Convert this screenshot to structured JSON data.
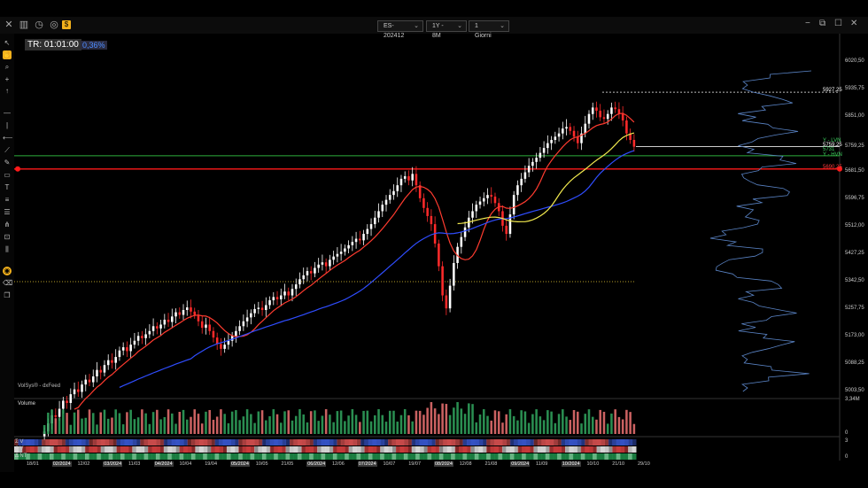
{
  "topbar": {
    "contract": "ES-202412",
    "range": "1Y - 8M",
    "period": "1 Giorni",
    "icons": [
      "close-icon",
      "layout-icon",
      "clock-icon",
      "target-icon",
      "dollar-icon"
    ],
    "window_buttons": [
      "minimize-icon",
      "restore-icon",
      "maximize-icon",
      "close-icon"
    ]
  },
  "tools": [
    "cursor-icon",
    "hand-icon",
    "zoom-icon",
    "crosshair-icon",
    "arrow-up-icon",
    "arrow-down-icon",
    "line-icon",
    "vline-icon",
    "ray-icon",
    "trendline-icon",
    "brush-icon",
    "rectangle-icon",
    "text-icon",
    "fib-icon",
    "channel-icon",
    "pitchfork-icon",
    "measure-icon",
    "bars-icon",
    "lock-icon",
    "eraser-icon",
    "layers-icon"
  ],
  "overlay": {
    "timer": "TR: 01:01:00",
    "pct": "0,36%",
    "source": "VolSys® - dxFeed"
  },
  "price_axis": [
    "6020,50",
    "5935,75",
    "5851,00",
    "5759,25",
    "5681,50",
    "5596,75",
    "5512,00",
    "5427,25",
    "5342,50",
    "5257,75",
    "5173,00",
    "5088,25",
    "5003,50"
  ],
  "price_tags": [
    {
      "label": "5927,25",
      "color": "#ffffff"
    },
    {
      "label": "5759,25",
      "color": "#ffffff"
    },
    {
      "label": "5690,25",
      "color": "#ff3b3b"
    }
  ],
  "level_labels": [
    "Y - LVN",
    "5731",
    "Y - HVN"
  ],
  "volume": {
    "label": "Volume",
    "axis_top": "3,34M",
    "axis_bottom": "0"
  },
  "heatmap": {
    "rows": [
      "Σ V",
      "Δ V",
      "Δ NT"
    ],
    "axis_top": "3",
    "axis_bottom": "0"
  },
  "dates": [
    {
      "label": "18/01",
      "hl": false
    },
    {
      "label": "02/2024",
      "hl": true
    },
    {
      "label": "12/02",
      "hl": false
    },
    {
      "label": "03/2024",
      "hl": true
    },
    {
      "label": "11/03",
      "hl": false
    },
    {
      "label": "04/2024",
      "hl": true
    },
    {
      "label": "10/04",
      "hl": false
    },
    {
      "label": "19/04",
      "hl": false
    },
    {
      "label": "05/2024",
      "hl": true
    },
    {
      "label": "10/05",
      "hl": false
    },
    {
      "label": "21/05",
      "hl": false
    },
    {
      "label": "06/2024",
      "hl": true
    },
    {
      "label": "12/06",
      "hl": false
    },
    {
      "label": "07/2024",
      "hl": true
    },
    {
      "label": "10/07",
      "hl": false
    },
    {
      "label": "19/07",
      "hl": false
    },
    {
      "label": "08/2024",
      "hl": true
    },
    {
      "label": "12/08",
      "hl": false
    },
    {
      "label": "21/08",
      "hl": false
    },
    {
      "label": "09/2024",
      "hl": true
    },
    {
      "label": "11/09",
      "hl": false
    },
    {
      "label": "10/2024",
      "hl": true
    },
    {
      "label": "10/10",
      "hl": false
    },
    {
      "label": "21/10",
      "hl": false
    },
    {
      "label": "29/10",
      "hl": false
    }
  ],
  "chart_data": {
    "type": "line",
    "ylim": [
      5003.5,
      6020.5
    ],
    "closes": [
      4880,
      4905,
      4930,
      4925,
      4950,
      4975,
      4968,
      4995,
      5010,
      5002,
      5025,
      5040,
      5032,
      5050,
      5070,
      5062,
      5085,
      5100,
      5092,
      5110,
      5130,
      5140,
      5128,
      5148,
      5160,
      5175,
      5168,
      5180,
      5190,
      5205,
      5198,
      5210,
      5225,
      5218,
      5235,
      5248,
      5240,
      5255,
      5263,
      5250,
      5240,
      5220,
      5200,
      5210,
      5190,
      5170,
      5150,
      5135,
      5148,
      5160,
      5175,
      5190,
      5205,
      5220,
      5232,
      5245,
      5258,
      5262,
      5255,
      5270,
      5285,
      5295,
      5288,
      5300,
      5312,
      5300,
      5320,
      5334,
      5350,
      5362,
      5375,
      5368,
      5385,
      5395,
      5402,
      5390,
      5410,
      5420,
      5428,
      5435,
      5445,
      5455,
      5465,
      5475,
      5470,
      5490,
      5505,
      5520,
      5540,
      5560,
      5580,
      5595,
      5610,
      5622,
      5640,
      5660,
      5668,
      5655,
      5675,
      5640,
      5600,
      5570,
      5545,
      5520,
      5460,
      5390,
      5300,
      5260,
      5330,
      5400,
      5450,
      5480,
      5510,
      5540,
      5560,
      5580,
      5590,
      5600,
      5610,
      5605,
      5585,
      5560,
      5515,
      5490,
      5550,
      5610,
      5640,
      5660,
      5680,
      5700,
      5712,
      5725,
      5740,
      5755,
      5770,
      5780,
      5790,
      5800,
      5815,
      5820,
      5808,
      5790,
      5770,
      5800,
      5830,
      5860,
      5880,
      5870,
      5850,
      5845,
      5860,
      5880,
      5875,
      5860,
      5840,
      5800,
      5780,
      5759
    ],
    "ma_fast": "red",
    "ma_mid": "yellow",
    "ma_slow": "blue"
  },
  "colors": {
    "bull": "#ffffff",
    "bear": "#ff2a2a",
    "ma_fast": "#ff3b2f",
    "ma_mid": "#f2e94e",
    "ma_slow": "#2f4dff",
    "profile": "#5a84c6"
  }
}
